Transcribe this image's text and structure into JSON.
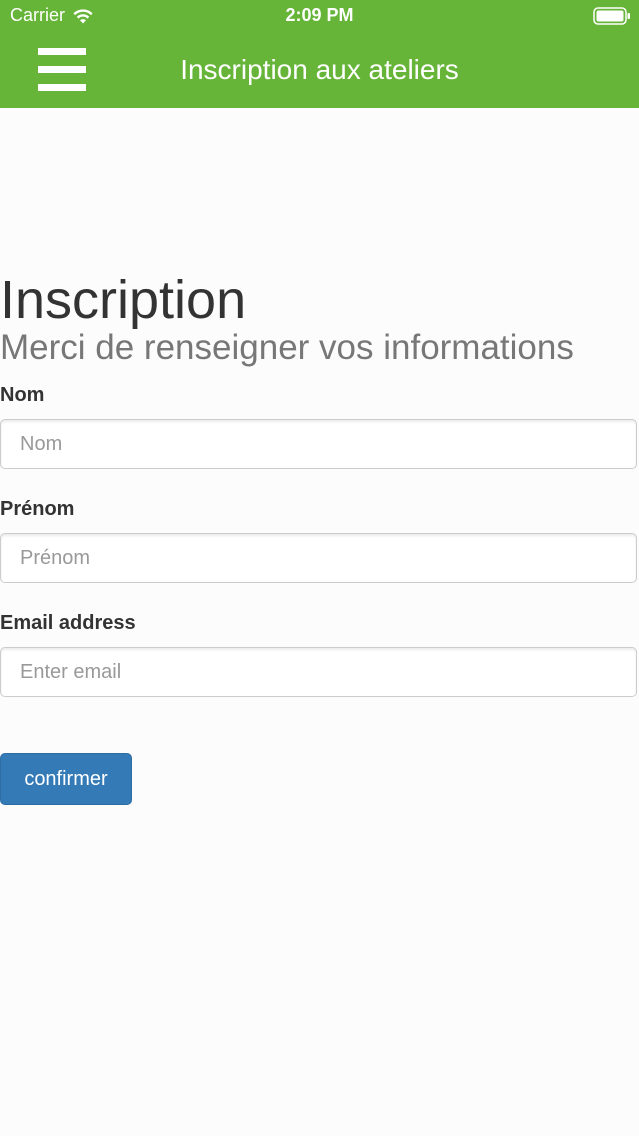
{
  "status_bar": {
    "carrier": "Carrier",
    "time": "2:09 PM",
    "icons": [
      "wifi-icon",
      "battery-icon"
    ]
  },
  "navbar": {
    "menu_icon": "hamburger-menu-icon",
    "title": "Inscription aux ateliers",
    "background_color": "#66b538"
  },
  "form": {
    "title": "Inscription",
    "subtitle": "Merci de renseigner vos informations",
    "fields": {
      "nom": {
        "label": "Nom",
        "placeholder": "Nom",
        "value": ""
      },
      "prenom": {
        "label": "Prénom",
        "placeholder": "Prénom",
        "value": ""
      },
      "email": {
        "label": "Email address",
        "placeholder": "Enter email",
        "value": ""
      }
    },
    "submit_label": "confirmer",
    "submit_color": "#337ab7"
  }
}
